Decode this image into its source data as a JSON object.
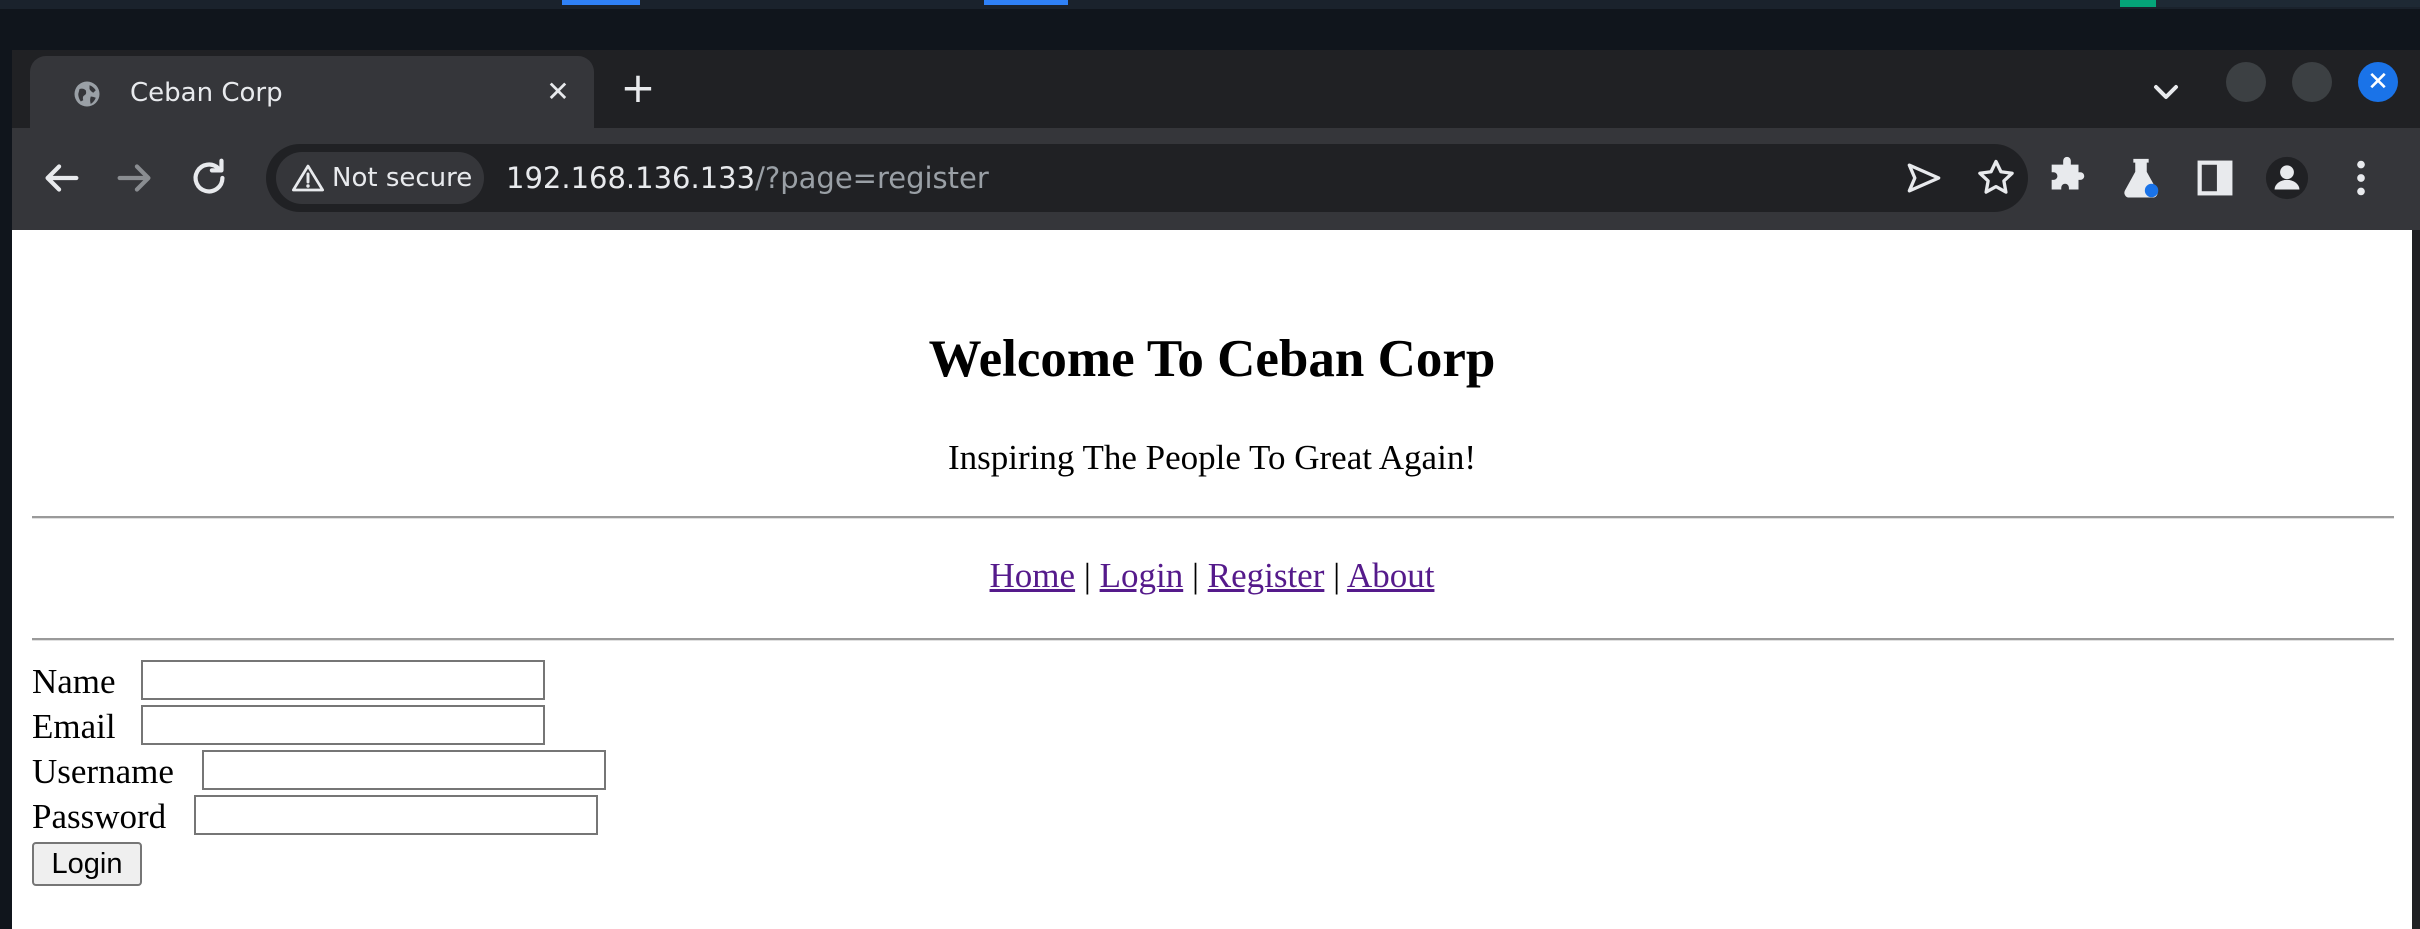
{
  "browser": {
    "tab": {
      "title": "Ceban Corp"
    },
    "address": {
      "security_label": "Not secure",
      "host": "192.168.136.133",
      "path": "/?page=register"
    }
  },
  "page": {
    "heading": "Welcome To Ceban Corp",
    "tagline": "Inspiring The People To Great Again!",
    "nav": {
      "home": "Home",
      "login": "Login",
      "register": "Register",
      "about": "About",
      "separator": "|"
    },
    "form": {
      "name_label": "Name",
      "email_label": "Email",
      "username_label": "Username",
      "password_label": "Password",
      "submit_label": "Login"
    }
  }
}
